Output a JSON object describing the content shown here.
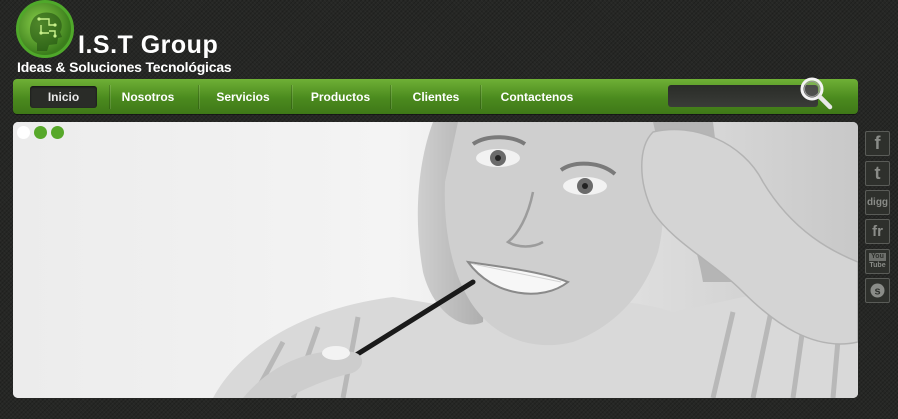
{
  "brand": {
    "title": "I.S.T Group",
    "subtitle": "Ideas & Soluciones Tecnológicas"
  },
  "nav": {
    "items": [
      {
        "label": "Inicio",
        "active": true
      },
      {
        "label": "Nosotros",
        "active": false
      },
      {
        "label": "Servicios",
        "active": false
      },
      {
        "label": "Productos",
        "active": false
      },
      {
        "label": "Clientes",
        "active": false
      },
      {
        "label": "Contactenos",
        "active": false
      }
    ],
    "search_placeholder": ""
  },
  "slider": {
    "dots": [
      "active",
      "inactive",
      "inactive"
    ],
    "image": "smiling-woman-with-pen"
  },
  "social": [
    {
      "name": "facebook-icon",
      "glyph": "f"
    },
    {
      "name": "twitter-icon",
      "glyph": "t"
    },
    {
      "name": "digg-icon",
      "glyph": "digg"
    },
    {
      "name": "friendfeed-icon",
      "glyph": "fr"
    },
    {
      "name": "youtube-icon",
      "glyph": "YouTube"
    },
    {
      "name": "skype-icon",
      "glyph": "s"
    }
  ],
  "colors": {
    "nav_green": "#4b8a1e",
    "accent_green": "#57a82a",
    "background": "#262725"
  }
}
